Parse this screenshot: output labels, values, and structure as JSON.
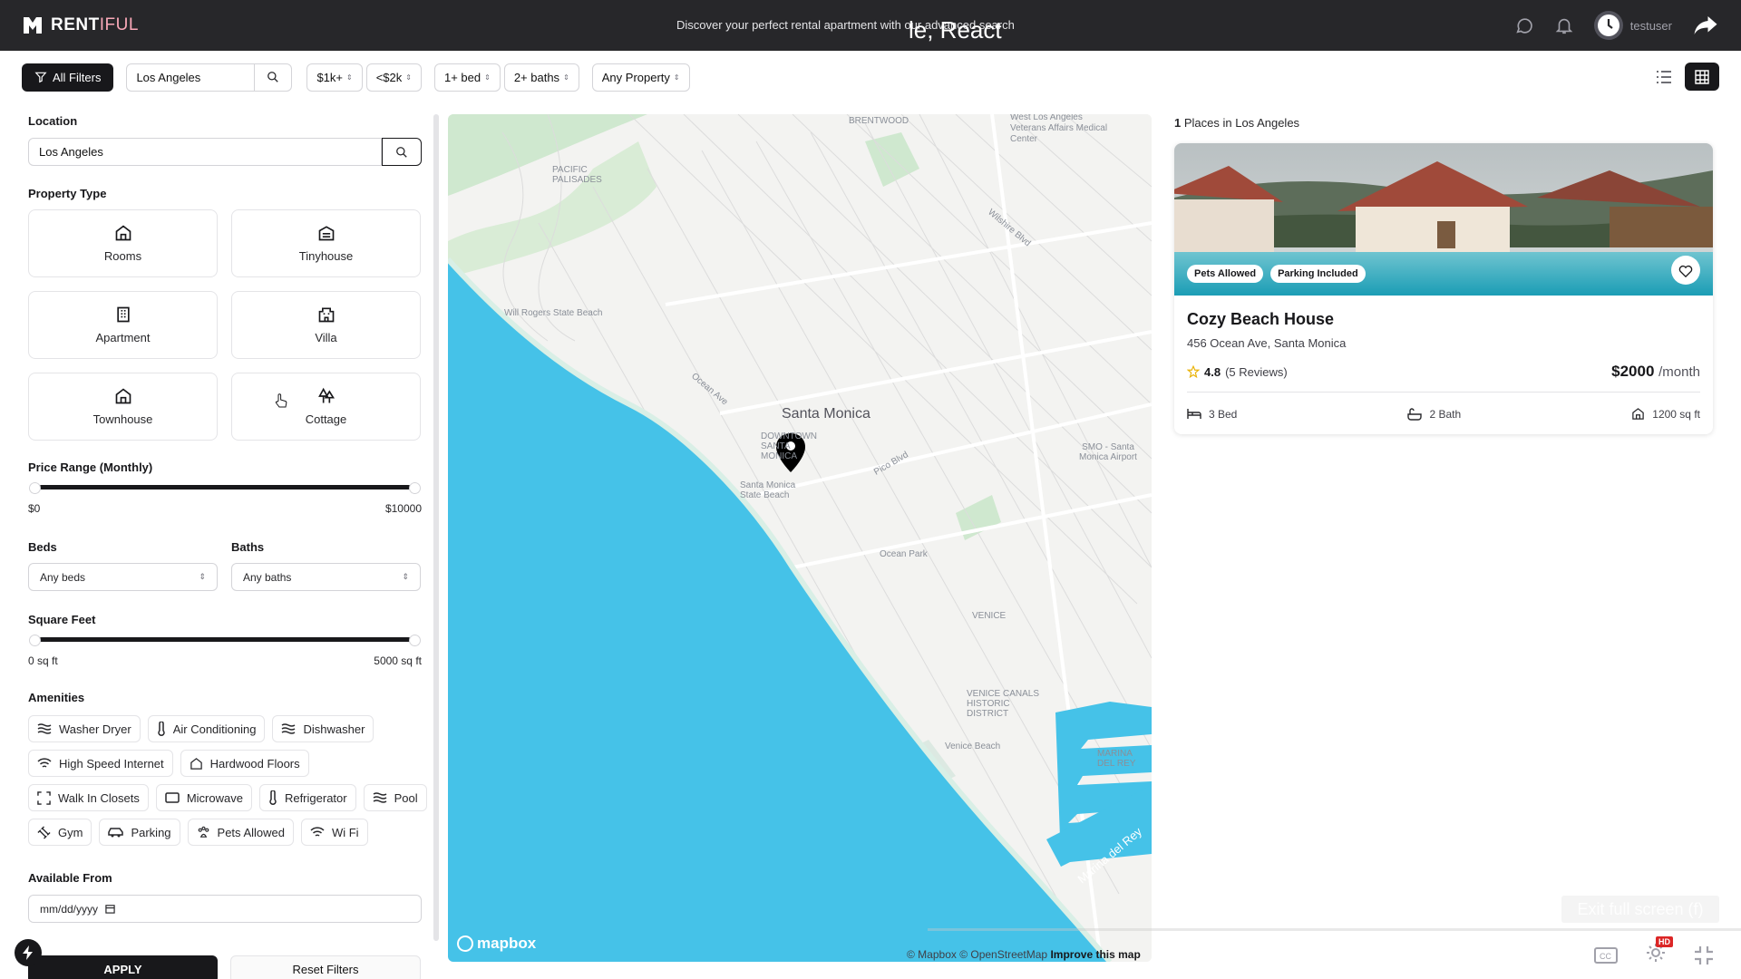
{
  "navbar": {
    "brand_bold": "RENT",
    "brand_light": "IFUL",
    "tagline": "Discover your perfect rental apartment with our advanced search",
    "overlay_title": "le, React",
    "user": "testuser"
  },
  "filterbar": {
    "all_filters": "All Filters",
    "search_value": "Los Angeles",
    "price_min": "$1k+",
    "price_max": "<$2k",
    "beds": "1+ bed",
    "baths": "2+ baths",
    "property": "Any Property"
  },
  "filters": {
    "location_title": "Location",
    "location_value": "Los Angeles",
    "property_type_title": "Property Type",
    "property_types": [
      "Rooms",
      "Tinyhouse",
      "Apartment",
      "Villa",
      "Townhouse",
      "Cottage"
    ],
    "price_title": "Price Range (Monthly)",
    "price_min_label": "$0",
    "price_max_label": "$10000",
    "beds_title": "Beds",
    "beds_value": "Any beds",
    "baths_title": "Baths",
    "baths_value": "Any baths",
    "sqft_title": "Square Feet",
    "sqft_min_label": "0 sq ft",
    "sqft_max_label": "5000 sq ft",
    "amenities_title": "Amenities",
    "amenities": [
      "Washer Dryer",
      "Air Conditioning",
      "Dishwasher",
      "High Speed Internet",
      "Hardwood Floors",
      "Walk In Closets",
      "Microwave",
      "Refrigerator",
      "Pool",
      "Gym",
      "Parking",
      "Pets Allowed",
      "Wi Fi"
    ],
    "available_title": "Available From",
    "date_placeholder": "mm/dd/yyyy",
    "apply": "APPLY",
    "reset": "Reset Filters"
  },
  "map": {
    "labels": [
      "BRENTWOOD",
      "West Los Angeles Veterans Affairs Medical Center",
      "PACIFIC PALISADES",
      "Will Rogers State Beach",
      "Santa Monica",
      "DOWNTOWN SANTA MONICA",
      "Santa Monica State Beach",
      "SMO - Santa Monica Airport",
      "Ocean Park",
      "VENICE",
      "VENICE CANALS HISTORIC DISTRICT",
      "Venice Beach",
      "MARINA DEL REY",
      "Marina del Rey",
      "Pico Blvd",
      "Ocean Ave",
      "Wilshire Blvd"
    ],
    "logo": "mapbox",
    "attribution": "© Mapbox © OpenStreetMap",
    "improve": "Improve this map"
  },
  "results": {
    "count": "1",
    "suffix": "Places in Los Angeles"
  },
  "listing": {
    "badges": [
      "Pets Allowed",
      "Parking Included"
    ],
    "title": "Cozy Beach House",
    "address": "456 Ocean Ave, Santa Monica",
    "rating": "4.8",
    "reviews": "(5 Reviews)",
    "price": "$2000",
    "per": "/month",
    "beds": "3 Bed",
    "baths": "2 Bath",
    "sqft": "1200 sq ft"
  },
  "video": {
    "exit_fullscreen": "Exit full screen (f)",
    "hd": "HD"
  },
  "colors": {
    "dark": "#18181b",
    "navbar": "#27272a",
    "water": "#45c2e8",
    "accent_pink": "#f9a8b8"
  }
}
